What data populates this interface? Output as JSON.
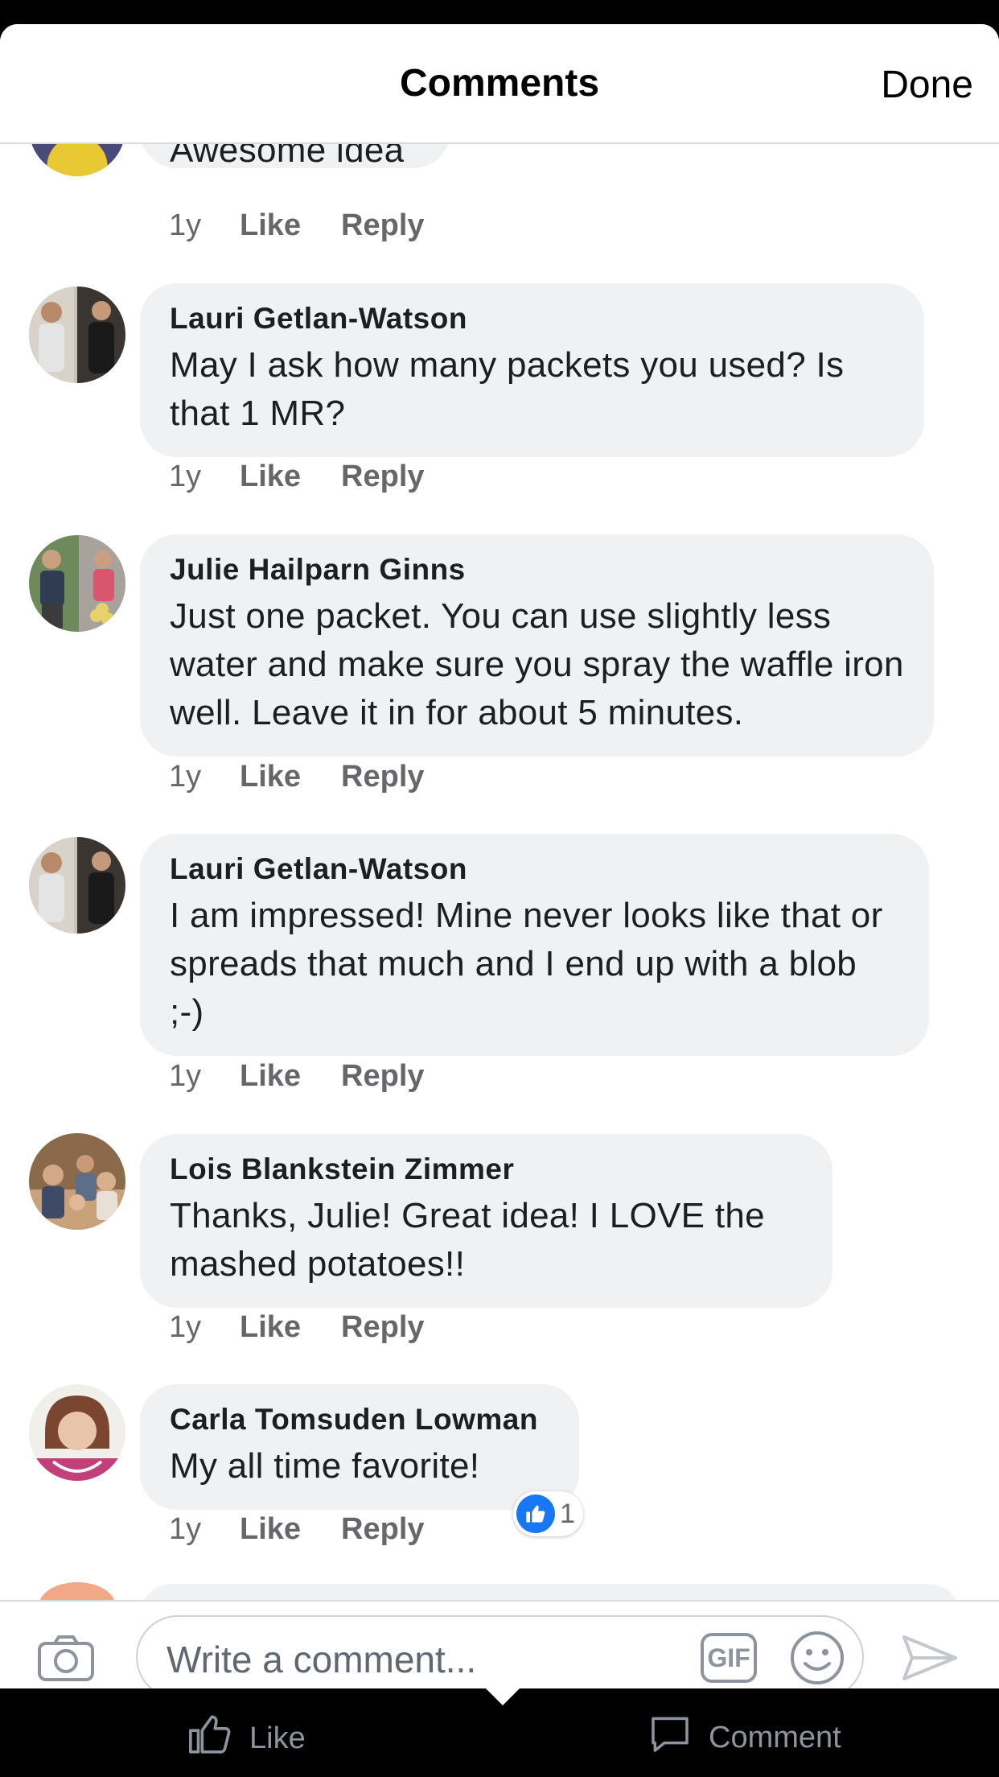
{
  "header": {
    "title": "Comments",
    "done_label": "Done"
  },
  "comments": [
    {
      "author": "",
      "text": "Awesome idea",
      "time": "1y",
      "like_label": "Like",
      "reply_label": "Reply"
    },
    {
      "author": "Lauri Getlan-Watson",
      "text": "May I ask how many packets you used? Is that 1 MR?",
      "time": "1y",
      "like_label": "Like",
      "reply_label": "Reply"
    },
    {
      "author": "Julie Hailparn Ginns",
      "text": "Just one packet.  You can use slightly less water and make sure you spray the waffle iron well.  Leave it in for about 5 minutes.",
      "time": "1y",
      "like_label": "Like",
      "reply_label": "Reply"
    },
    {
      "author": "Lauri Getlan-Watson",
      "text": "I am impressed! Mine never looks like that or spreads that much and I end up with a blob ;-)",
      "time": "1y",
      "like_label": "Like",
      "reply_label": "Reply"
    },
    {
      "author": "Lois Blankstein Zimmer",
      "text": "Thanks, Julie! Great idea! I LOVE the mashed potatoes!!",
      "time": "1y",
      "like_label": "Like",
      "reply_label": "Reply"
    },
    {
      "author": "Carla Tomsuden Lowman",
      "text": "My all time favorite!",
      "time": "1y",
      "like_label": "Like",
      "reply_label": "Reply",
      "reaction_count": "1"
    }
  ],
  "composer": {
    "placeholder": "Write a comment...",
    "gif_label": "GIF"
  },
  "tabbar": {
    "like_label": "Like",
    "comment_label": "Comment"
  },
  "colors": {
    "like_blue": "#1877f2",
    "bubble": "#f0f1f3",
    "meta_gray": "#65676b"
  },
  "icons": [
    "camera-icon",
    "gif-icon",
    "smiley-icon",
    "send-icon",
    "thumbs-up-icon",
    "comment-icon"
  ]
}
